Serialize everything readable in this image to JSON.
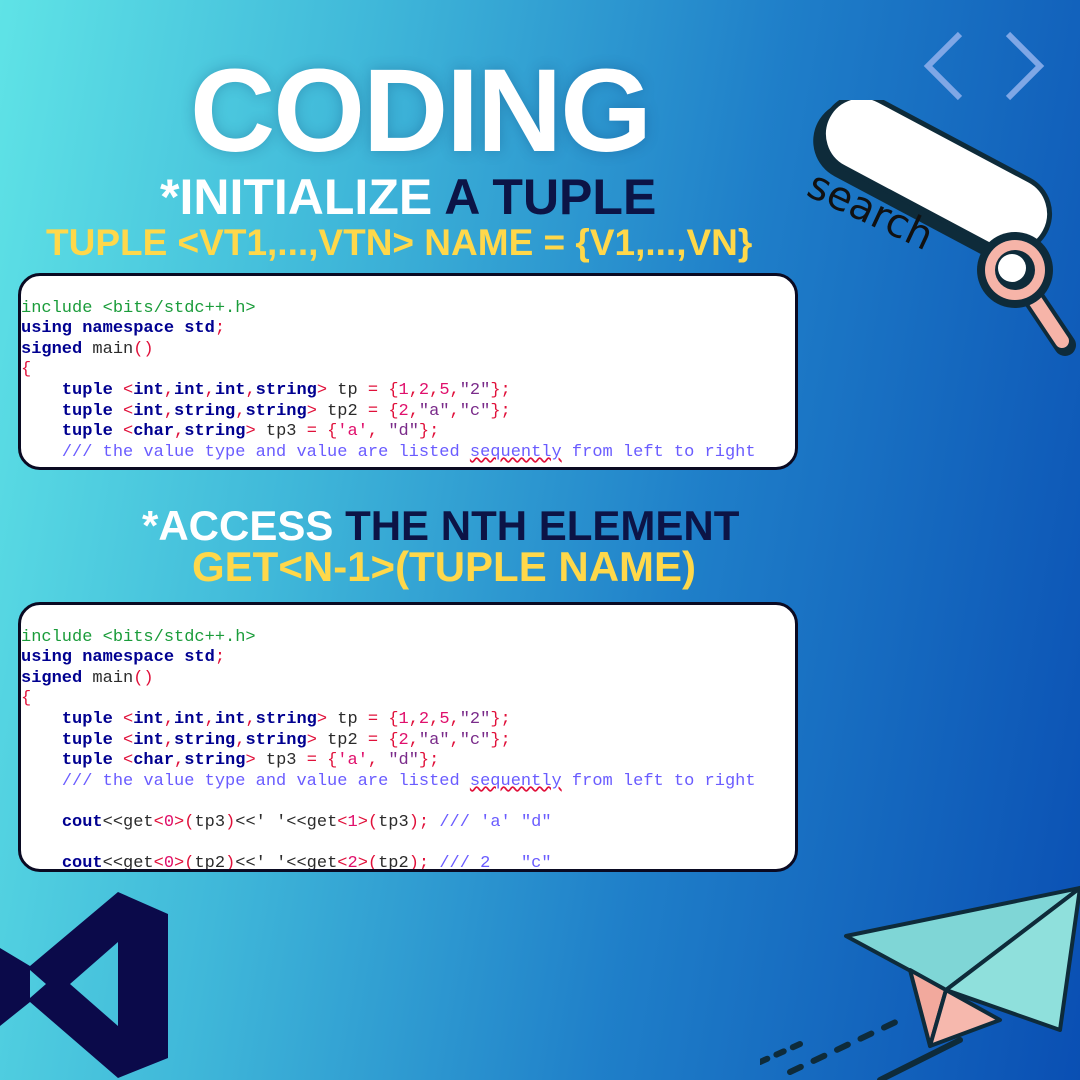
{
  "title": "CODING",
  "section1": {
    "prefix": "*INITIALIZE",
    "rest": "A TUPLE",
    "syntax": "TUPLE <VT1,...,VTN> NAME = {V1,...,VN}"
  },
  "section2": {
    "prefix": "*ACCESS",
    "rest": "THE NTH ELEMENT",
    "syntax": "GET<N-1>(TUPLE NAME)"
  },
  "search": {
    "label": "search"
  },
  "code1": [
    "include <bits/stdc++.h>",
    "using namespace std;",
    "signed main()",
    "{",
    "tuple <int,int,int,string> tp = {1,2,5,\"2\"};",
    "tuple <int,string,string> tp2 = {2,\"a\",\"c\"};",
    "tuple <char,string> tp3 = {'a', \"d\"};",
    "/// the value type and value are listed sequently from left to right",
    "}"
  ],
  "code2": [
    "include <bits/stdc++.h>",
    "using namespace std;",
    "signed main()",
    "{",
    "tuple <int,int,int,string> tp = {1,2,5,\"2\"};",
    "tuple <int,string,string> tp2 = {2,\"a\",\"c\"};",
    "tuple <char,string> tp3 = {'a', \"d\"};",
    "/// the value type and value are listed sequently from left to right",
    "",
    "cout<<get<0>(tp3)<<' '<<get<1>(tp3); /// 'a' \"d\"",
    "",
    "cout<<get<0>(tp2)<<' '<<get<2>(tp2); /// 2   \"c\""
  ],
  "colors": {
    "keyword": "#000090",
    "preprocessor": "#1a9c3a",
    "number": "#e0106c",
    "comment": "#6a5cff",
    "heading_accent": "#ffd84a",
    "heading_dark": "#0c1446"
  },
  "icons": [
    "code-chevrons-icon",
    "search-bar-icon",
    "magnifier-icon",
    "visual-studio-logo-icon",
    "paper-plane-icon"
  ]
}
